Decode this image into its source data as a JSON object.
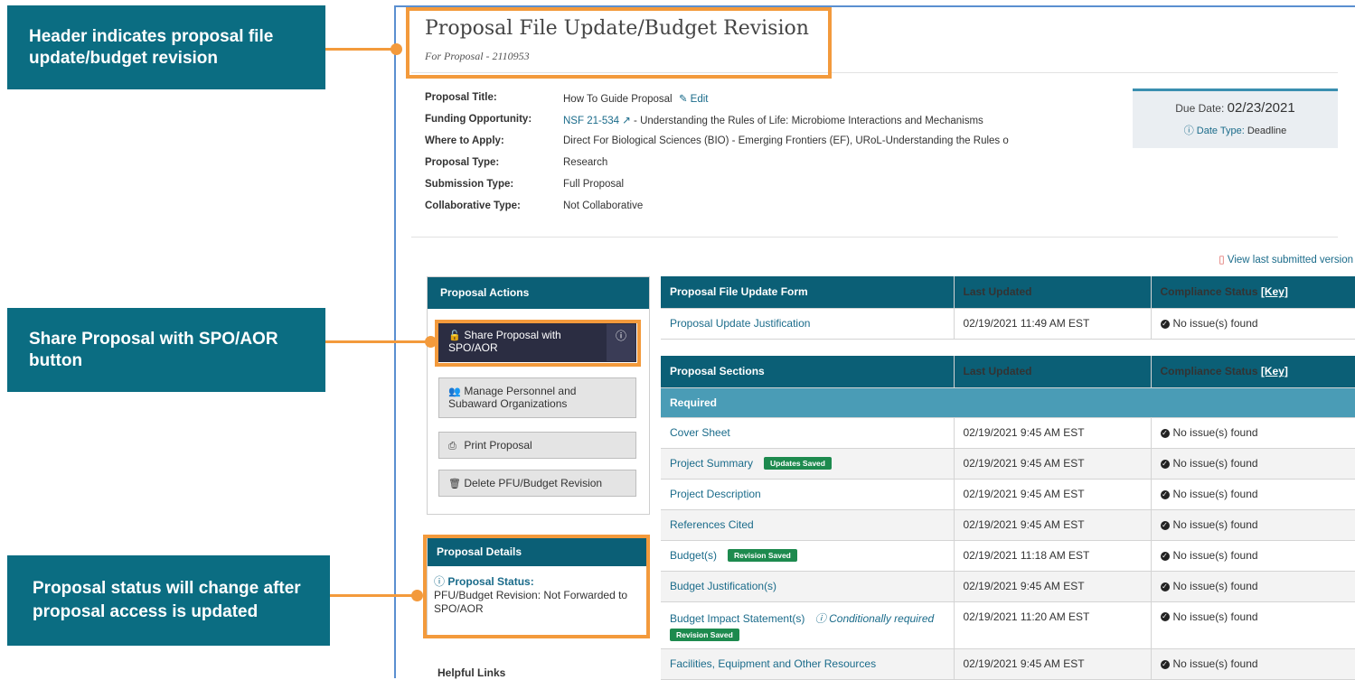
{
  "callouts": {
    "header": "Header indicates proposal file update/budget revision",
    "share": "Share Proposal with SPO/AOR button",
    "status": "Proposal status will change after proposal access is updated"
  },
  "header": {
    "title": "Proposal File Update/Budget Revision",
    "subtitle": "For Proposal - 2110953"
  },
  "info": {
    "proposal_title_label": "Proposal Title:",
    "proposal_title": "How To Guide Proposal",
    "edit_label": "Edit",
    "funding_label": "Funding Opportunity:",
    "funding_link": "NSF 21-534",
    "funding_text": " - Understanding the Rules of Life: Microbiome Interactions and Mechanisms",
    "where_label": "Where to Apply:",
    "where": "Direct For Biological Sciences (BIO) - Emerging Frontiers (EF), URoL-Understanding the Rules o",
    "type_label": "Proposal Type:",
    "type": "Research",
    "submission_label": "Submission Type:",
    "submission": "Full Proposal",
    "collab_label": "Collaborative Type:",
    "collab": "Not Collaborative"
  },
  "due": {
    "label": "Due Date:",
    "date": "02/23/2021",
    "type_label": "Date Type:",
    "type": "Deadline"
  },
  "view_last": "View last submitted version",
  "actions": {
    "head": "Proposal Actions",
    "share": "Share Proposal with SPO/AOR",
    "manage": "Manage Personnel and Subaward Organizations",
    "print": "Print Proposal",
    "delete": "Delete PFU/Budget Revision"
  },
  "details": {
    "head": "Proposal Details",
    "status_label": "Proposal Status:",
    "status": "PFU/Budget Revision: Not Forwarded to SPO/AOR"
  },
  "helpful_links": "Helpful Links",
  "pfu_table": {
    "headers": [
      "Proposal File Update Form",
      "Last Updated",
      "Compliance Status"
    ],
    "key": "[Key]",
    "rows": [
      {
        "name": "Proposal Update Justification",
        "updated": "02/19/2021 11:49 AM EST",
        "status": "No issue(s) found"
      }
    ]
  },
  "sections_table": {
    "headers": [
      "Proposal Sections",
      "Last Updated",
      "Compliance Status"
    ],
    "key": "[Key]",
    "required_label": "Required",
    "rows": [
      {
        "name": "Cover Sheet",
        "updated": "02/19/2021 9:45 AM EST",
        "status": "No issue(s) found"
      },
      {
        "name": "Project Summary",
        "badge": "Updates Saved",
        "updated": "02/19/2021 9:45 AM EST",
        "status": "No issue(s) found"
      },
      {
        "name": "Project Description",
        "updated": "02/19/2021 9:45 AM EST",
        "status": "No issue(s) found"
      },
      {
        "name": "References Cited",
        "updated": "02/19/2021 9:45 AM EST",
        "status": "No issue(s) found"
      },
      {
        "name": "Budget(s)",
        "badge": "Revision Saved",
        "updated": "02/19/2021 11:18 AM EST",
        "status": "No issue(s) found"
      },
      {
        "name": "Budget Justification(s)",
        "updated": "02/19/2021 9:45 AM EST",
        "status": "No issue(s) found"
      },
      {
        "name": "Budget Impact Statement(s)",
        "note": "Conditionally required",
        "badge": "Revision Saved",
        "updated": "02/19/2021 11:20 AM EST",
        "status": "No issue(s) found"
      },
      {
        "name": "Facilities, Equipment and Other Resources",
        "updated": "02/19/2021 9:45 AM EST",
        "status": "No issue(s) found"
      }
    ]
  }
}
